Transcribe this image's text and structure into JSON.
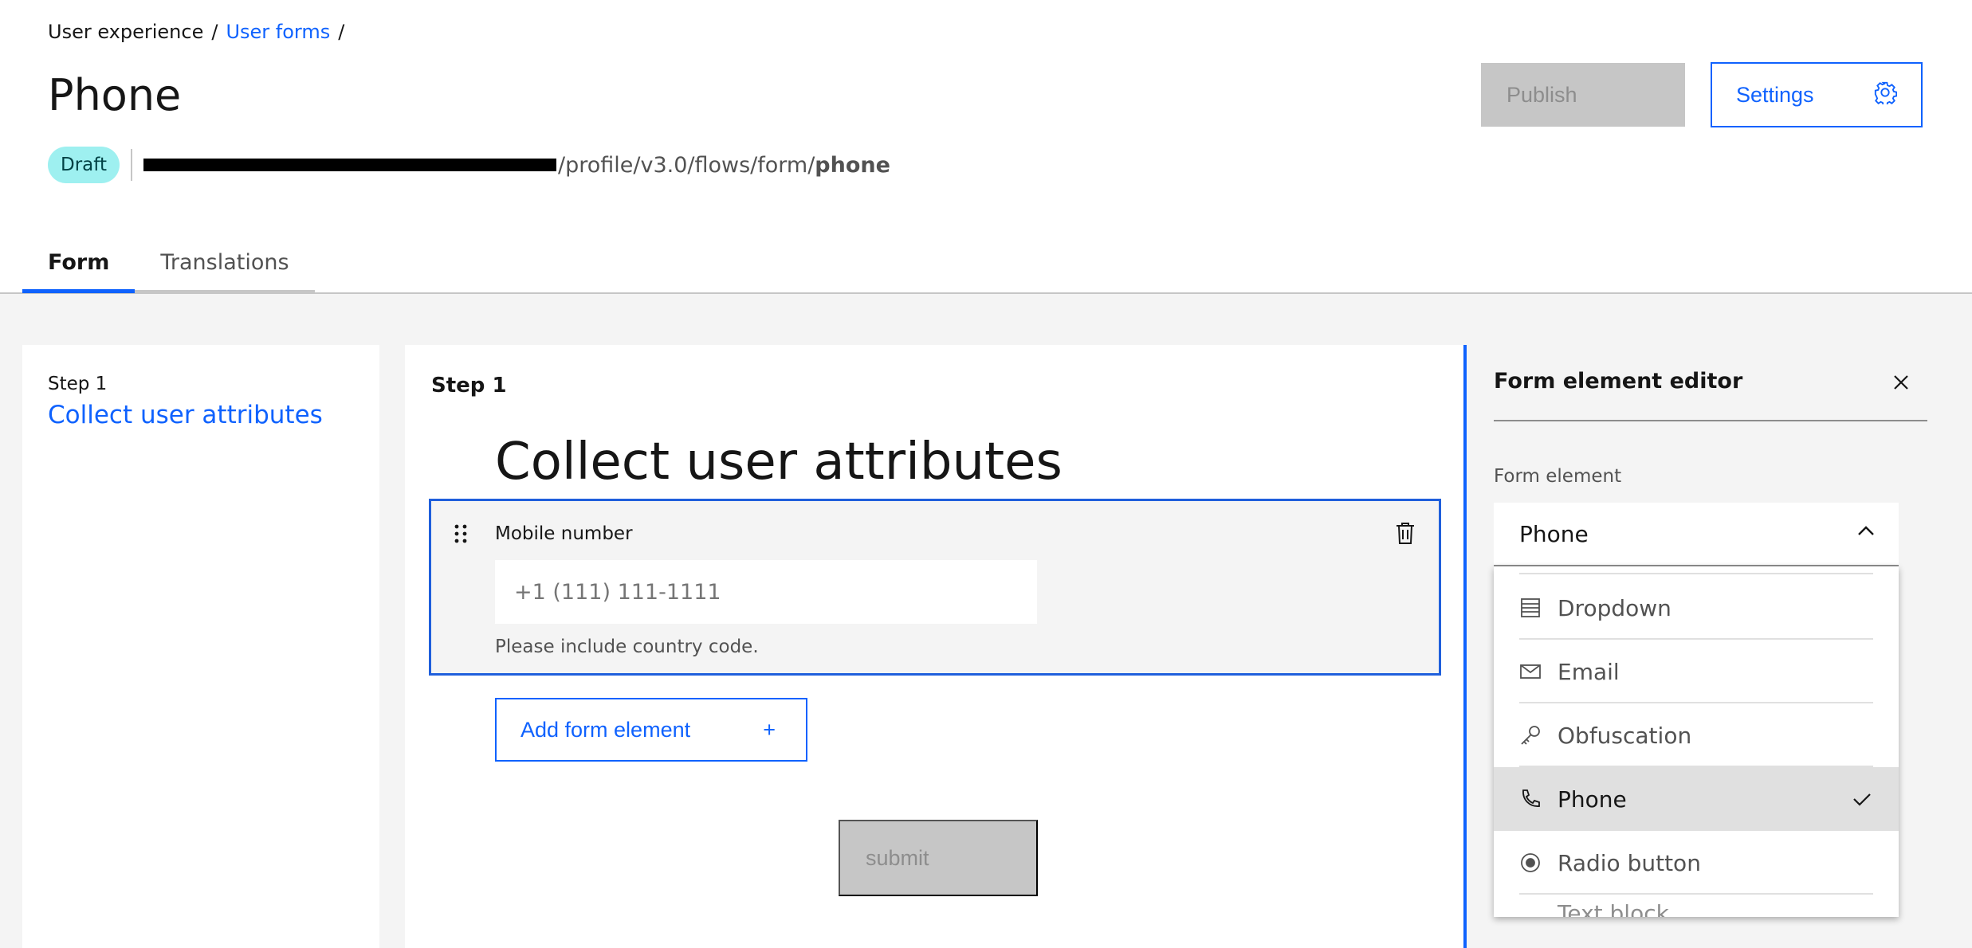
{
  "breadcrumb": {
    "root": "User experience",
    "sep1": "/",
    "link": "User forms",
    "sep2": "/"
  },
  "header": {
    "title": "Phone",
    "status": "Draft",
    "url_path": "/profile/v3.0/flows/form/",
    "url_bold": "phone",
    "publish_label": "Publish",
    "settings_label": "Settings"
  },
  "tabs": [
    {
      "label": "Form",
      "active": true
    },
    {
      "label": "Translations",
      "active": false
    }
  ],
  "steps_panel": {
    "step_label": "Step 1",
    "step_title": "Collect user attributes"
  },
  "form": {
    "step_label": "Step 1",
    "heading": "Collect user attributes",
    "element": {
      "label": "Mobile number",
      "placeholder": "+1 (111) 111-1111",
      "helper": "Please include country code."
    },
    "add_label": "Add form element",
    "add_icon": "+",
    "submit_label": "submit"
  },
  "editor": {
    "title": "Form element editor",
    "field_label": "Form element",
    "selected": "Phone",
    "options": [
      {
        "label": "Dropdown",
        "icon": "list-icon"
      },
      {
        "label": "Email",
        "icon": "envelope-icon"
      },
      {
        "label": "Obfuscation",
        "icon": "key-icon"
      },
      {
        "label": "Phone",
        "icon": "phone-icon",
        "selected": true
      },
      {
        "label": "Radio button",
        "icon": "radio-icon"
      },
      {
        "label": "Text block",
        "icon": "text-icon"
      }
    ]
  },
  "colors": {
    "accent": "#0f62fe",
    "draft_bg": "#9ef0f0",
    "disabled": "#c6c6c6"
  }
}
